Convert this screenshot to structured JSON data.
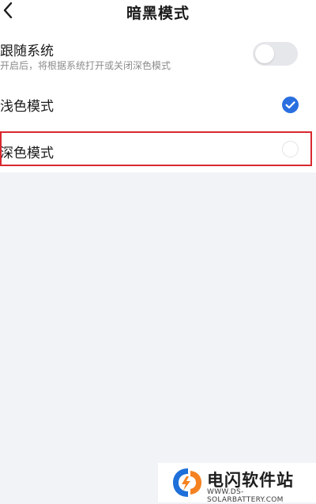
{
  "header": {
    "title": "暗黑模式",
    "back_icon": "chevron-left-icon"
  },
  "follow_system": {
    "label": "跟随系统",
    "description": "开启后，将根据系统打开或关闭深色模式",
    "enabled": false
  },
  "light_mode": {
    "label": "浅色模式",
    "selected": true
  },
  "dark_mode": {
    "label": "深色模式",
    "selected": false
  },
  "watermark": {
    "name": "电闪软件站",
    "url": "WWW.DS-SOLARBATTERY.COM"
  },
  "colors": {
    "accent": "#2a6fe0",
    "highlight": "#d9282f",
    "background": "#f2f3f7"
  }
}
